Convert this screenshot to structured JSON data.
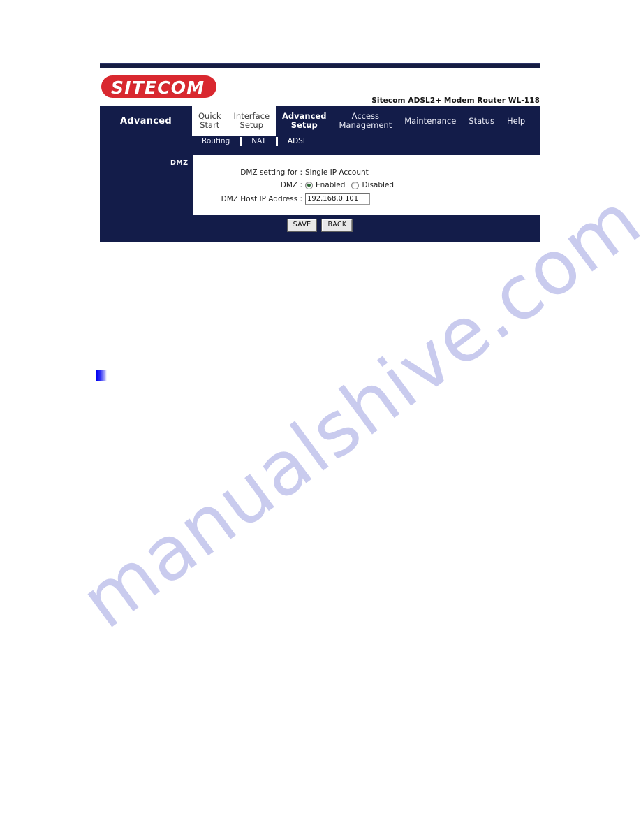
{
  "document": {
    "watermark": "manualshive.com"
  },
  "router_ui": {
    "brand": {
      "logo_text": "SITECOM",
      "logo_color": "#d9282f",
      "model_line": "Sitecom ADSL2+ Modem Router WL-118"
    },
    "nav": {
      "section_title": "Advanced",
      "tabs": [
        {
          "line1": "Quick",
          "line2": "Start",
          "active": false,
          "on_white": true
        },
        {
          "line1": "Interface",
          "line2": "Setup",
          "active": false,
          "on_white": true
        },
        {
          "line1": "Advanced",
          "line2": "Setup",
          "active": true,
          "on_white": false
        },
        {
          "line1": "Access",
          "line2": "Management",
          "active": false,
          "on_white": false
        },
        {
          "line1": "Maintenance",
          "line2": "",
          "active": false,
          "on_white": false
        },
        {
          "line1": "Status",
          "line2": "",
          "active": false,
          "on_white": false
        },
        {
          "line1": "Help",
          "line2": "",
          "active": false,
          "on_white": false
        }
      ],
      "subtabs": [
        {
          "label": "Routing",
          "active": false
        },
        {
          "label": "NAT",
          "active": false
        },
        {
          "label": "ADSL",
          "active": true
        }
      ]
    },
    "form": {
      "group_label": "DMZ",
      "setting_for_label": "DMZ setting for :",
      "setting_for_value": "Single IP Account",
      "dmz_label": "DMZ :",
      "radio_enabled_label": "Enabled",
      "radio_disabled_label": "Disabled",
      "dmz_selected": "Enabled",
      "host_ip_label": "DMZ Host IP Address :",
      "host_ip_value": "192.168.0.101"
    },
    "buttons": {
      "save": "SAVE",
      "back": "BACK"
    },
    "colors": {
      "navy": "#131c49",
      "brand_red": "#d9282f",
      "radio_dot": "#2f6b36"
    }
  }
}
